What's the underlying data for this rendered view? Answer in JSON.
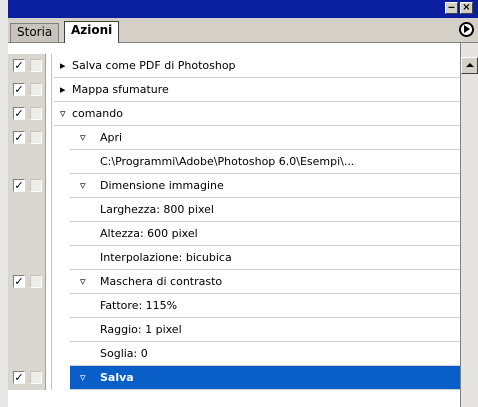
{
  "window": {
    "minimize_glyph": "‒",
    "close_glyph": "×"
  },
  "tabs": [
    {
      "label": "Storia",
      "active": false
    },
    {
      "label": "Azioni",
      "active": true
    }
  ],
  "rows": [
    {
      "checked": true,
      "triangle": "▸",
      "indent": 1,
      "label": "Salva come PDF di Photoshop",
      "selected": false
    },
    {
      "checked": true,
      "triangle": "▸",
      "indent": 1,
      "label": "Mappa sfumature",
      "selected": false
    },
    {
      "checked": true,
      "triangle": "▿",
      "indent": 1,
      "label": "comando",
      "selected": false
    },
    {
      "checked": true,
      "triangle": "▿",
      "indent": 2,
      "label": "Apri",
      "selected": false
    },
    {
      "checked": false,
      "triangle": "",
      "indent": 3,
      "label": "C:\\Programmi\\Adobe\\Photoshop 6.0\\Esempi\\...",
      "selected": false
    },
    {
      "checked": true,
      "triangle": "▿",
      "indent": 2,
      "label": "Dimensione immagine",
      "selected": false
    },
    {
      "checked": false,
      "triangle": "",
      "indent": 3,
      "label": "Larghezza: 800 pixel",
      "selected": false
    },
    {
      "checked": false,
      "triangle": "",
      "indent": 3,
      "label": "Altezza: 600 pixel",
      "selected": false
    },
    {
      "checked": false,
      "triangle": "",
      "indent": 3,
      "label": "Interpolazione: bicubica",
      "selected": false
    },
    {
      "checked": true,
      "triangle": "▿",
      "indent": 2,
      "label": "Maschera di contrasto",
      "selected": false
    },
    {
      "checked": false,
      "triangle": "",
      "indent": 3,
      "label": "Fattore: 115%",
      "selected": false
    },
    {
      "checked": false,
      "triangle": "",
      "indent": 3,
      "label": "Raggio: 1 pixel",
      "selected": false
    },
    {
      "checked": false,
      "triangle": "",
      "indent": 3,
      "label": "Soglia: 0",
      "selected": false
    },
    {
      "checked": true,
      "triangle": "▿",
      "indent": 2,
      "label": "Salva",
      "selected": true
    }
  ]
}
